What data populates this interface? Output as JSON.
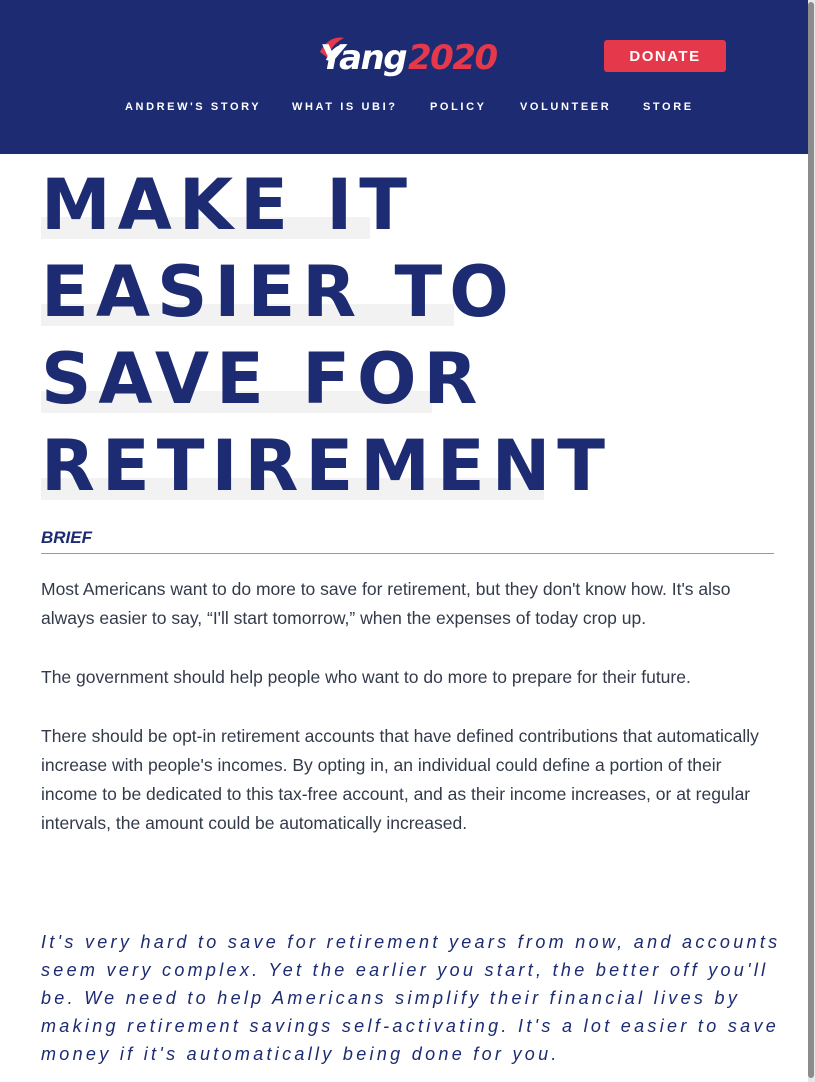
{
  "header": {
    "logo": {
      "word": "Yang",
      "year": "2020"
    },
    "donate_label": "DONATE",
    "nav": [
      "ANDREW'S STORY",
      "WHAT IS UBI?",
      "POLICY",
      "VOLUNTEER",
      "STORE"
    ],
    "colors": {
      "background": "#1c2b72",
      "accent": "#e5384a"
    }
  },
  "title": {
    "lines": [
      "MAKE IT",
      "EASIER TO",
      "SAVE FOR",
      "RETIREMENT"
    ]
  },
  "brief": {
    "label": "BRIEF",
    "paragraphs": [
      "Most Americans want to do more to save for retirement, but they don't know how. It's also always easier to say, “I'll start tomorrow,” when the expenses of today crop up.",
      "The government should help people who want to do more to prepare for their future.",
      "There should be opt-in retirement accounts that have defined contributions that automatically increase with people's incomes. By opting in, an individual could define a portion of their income to be dedicated to this tax-free account, and as their income increases, or at regular intervals, the amount could be automatically increased."
    ]
  },
  "quote": "It's very hard to save for retirement years from now, and accounts seem very complex. Yet the earlier you start, the better off you'll be. We need to help Americans simplify their financial lives by making retirement savings self-activating. It's a lot easier to save money if it's automatically being done for you."
}
